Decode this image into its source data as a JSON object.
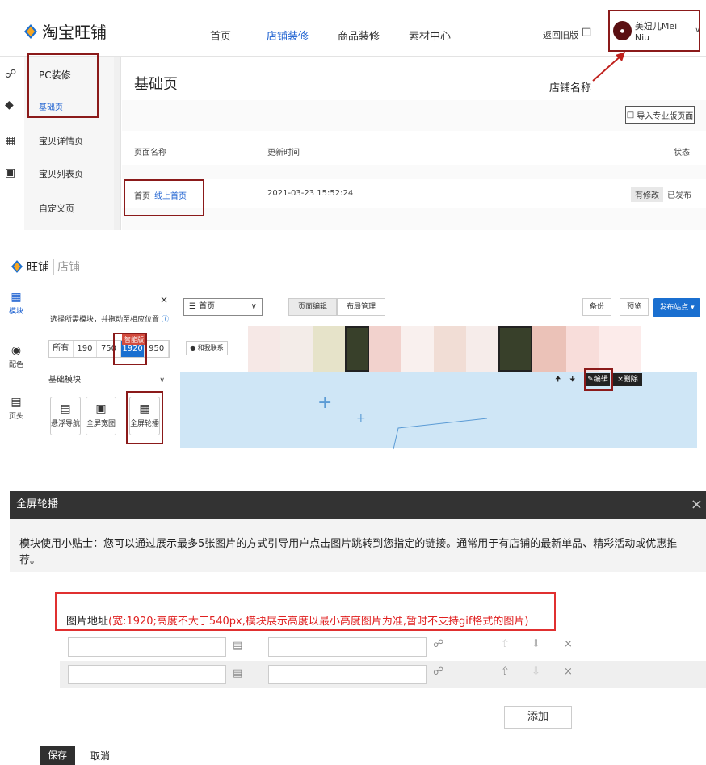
{
  "panel1": {
    "logo": "淘宝旺铺",
    "nav": [
      "首页",
      "店铺装修",
      "商品装修",
      "素材中心"
    ],
    "back_old": "返回旧版",
    "user_name": "美妞儿Mei Niu",
    "menu": {
      "group": "PC装修",
      "items": [
        "基础页",
        "宝贝详情页",
        "宝贝列表页",
        "自定义页"
      ]
    },
    "page_title": "基础页",
    "annotation": "店铺名称",
    "import_btn": "导入专业版页面",
    "table": {
      "headers": [
        "页面名称",
        "更新时间",
        "状态"
      ],
      "row": {
        "name": "首页",
        "online": "线上首页",
        "time": "2021-03-23 15:52:24",
        "modified": "有修改",
        "published": "已发布"
      }
    }
  },
  "panel2": {
    "logo": "旺铺",
    "logo_sub": "店铺",
    "rail": [
      "模块",
      "配色",
      "页头"
    ],
    "hint": "选择所需模块，并拖动至相应位置",
    "filters": [
      "所有",
      "190",
      "750",
      "1920",
      "950"
    ],
    "badge": "智能版",
    "section": "基础模块",
    "modules": [
      "悬浮导航",
      "全屏宽图",
      "全屏轮播"
    ],
    "page_select": "首页",
    "tab_edit": "页面编辑",
    "tab_layout": "布局管理",
    "backup": "备份",
    "preview": "预览",
    "publish": "发布站点",
    "contact": "和我联系",
    "edit": "编辑",
    "delete": "删除"
  },
  "panel3": {
    "title": "全屏轮播",
    "tip": "模块使用小贴士：您可以通过展示最多5张图片的方式引导用户点击图片跳转到您指定的链接。通常用于有店铺的最新单品、精彩活动或优惠推荐。",
    "label": "图片地址",
    "requirement": "(宽:1920;高度不大于540px,模块展示高度以最小高度图片为准,暂时不支持gif格式的图片)",
    "add": "添加",
    "save": "保存",
    "cancel": "取消"
  }
}
